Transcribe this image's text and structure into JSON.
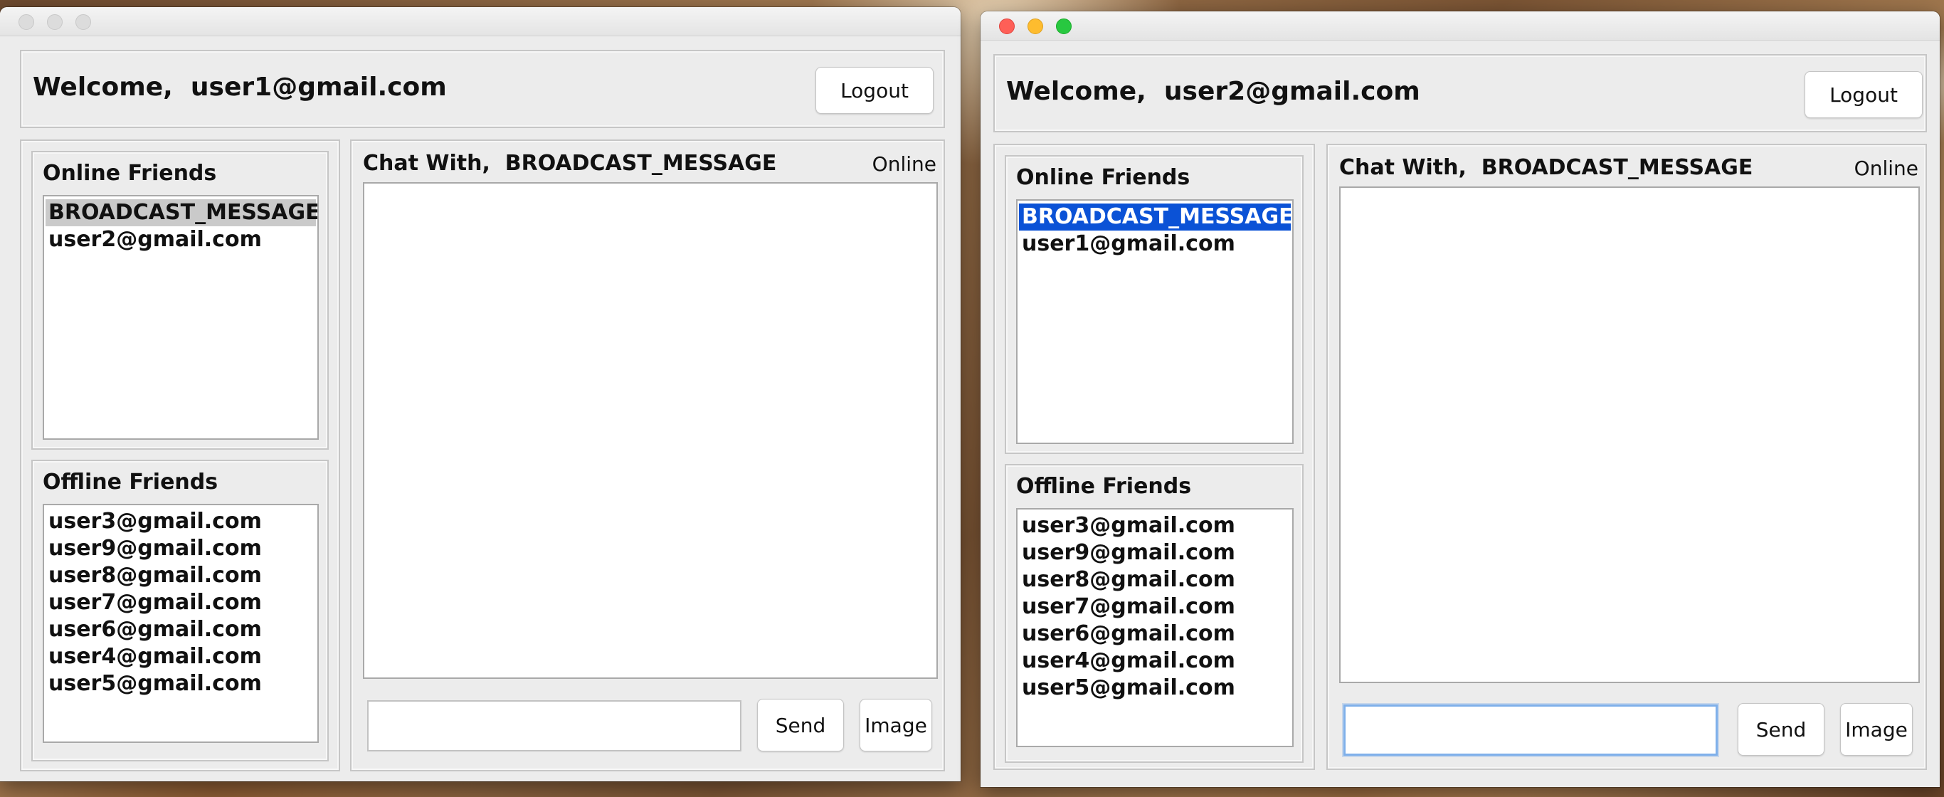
{
  "windows": [
    {
      "welcome": "Welcome,  user1@gmail.com",
      "logout_label": "Logout",
      "online_friends": {
        "label": "Online Friends",
        "items": [
          "BROADCAST_MESSAGE",
          "user2@gmail.com"
        ],
        "selected": "BROADCAST_MESSAGE"
      },
      "offline_friends": {
        "label": "Offline Friends",
        "items": [
          "user3@gmail.com",
          "user9@gmail.com",
          "user8@gmail.com",
          "user7@gmail.com",
          "user6@gmail.com",
          "user4@gmail.com",
          "user5@gmail.com"
        ]
      },
      "chat": {
        "title": "Chat With,  BROADCAST_MESSAGE",
        "status": "Online",
        "input_value": "",
        "send_label": "Send",
        "image_label": "Image"
      }
    },
    {
      "welcome": "Welcome,  user2@gmail.com",
      "logout_label": "Logout",
      "online_friends": {
        "label": "Online Friends",
        "items": [
          "BROADCAST_MESSAGE",
          "user1@gmail.com"
        ],
        "selected": "BROADCAST_MESSAGE"
      },
      "offline_friends": {
        "label": "Offline Friends",
        "items": [
          "user3@gmail.com",
          "user9@gmail.com",
          "user8@gmail.com",
          "user7@gmail.com",
          "user6@gmail.com",
          "user4@gmail.com",
          "user5@gmail.com"
        ]
      },
      "chat": {
        "title": "Chat With,  BROADCAST_MESSAGE",
        "status": "Online",
        "input_value": "",
        "send_label": "Send",
        "image_label": "Image"
      }
    }
  ],
  "colors": {
    "selection_active": "#0b52d6",
    "selection_inactive": "#cacaca",
    "window_bg": "#ececec"
  }
}
